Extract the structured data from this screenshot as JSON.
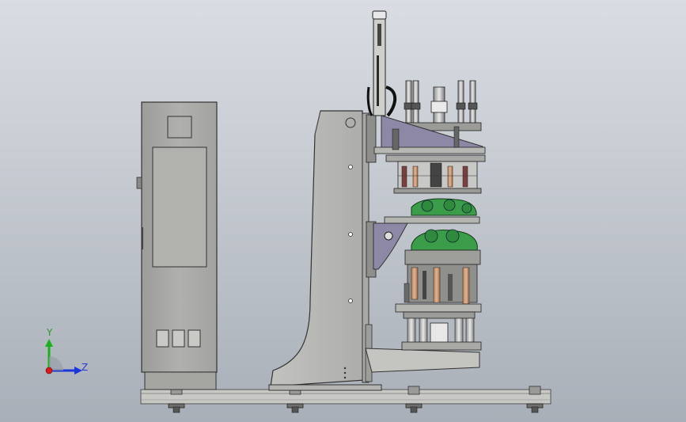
{
  "viewport": {
    "background": [
      "#d9dde3",
      "#a9afb8"
    ]
  },
  "triad": {
    "y_label": "Y",
    "z_label": "Z",
    "y_color": "#1ab01a",
    "z_color": "#1a35d8",
    "origin_color": "#d81a1a"
  },
  "colors": {
    "cabinet": "#a8a8a6",
    "cabinet_panel": "#b4b4b1",
    "frame": "#b9b9b6",
    "base_rail": "#c9c9c6",
    "purple_plate": "#8f8aa8",
    "green_parts": "#3aa44a",
    "dark": "#2e2e2e"
  },
  "model": {
    "description_parts": [
      "control-cabinet",
      "machine-frame",
      "linear-actuator",
      "top-cylinder-assembly",
      "upper-fixture",
      "middle-fixture",
      "lower-fixture",
      "base-rail",
      "leveling-feet"
    ]
  }
}
